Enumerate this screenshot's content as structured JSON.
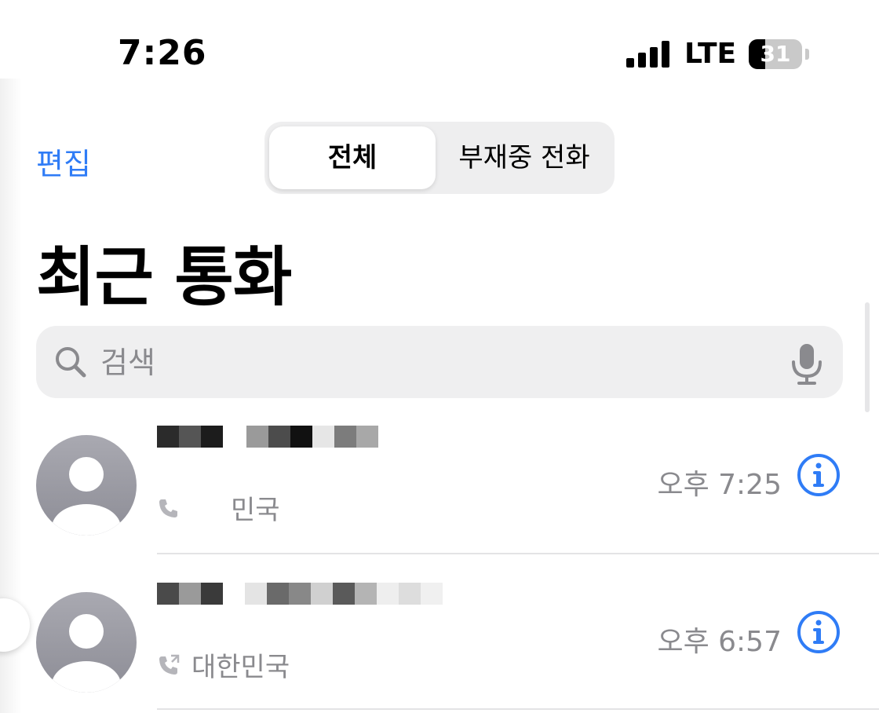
{
  "status_bar": {
    "time": "7:26",
    "network": "LTE",
    "battery": "31",
    "battery_level": 0.31
  },
  "nav": {
    "edit_label": "편집",
    "segments": [
      {
        "label": "전체",
        "selected": true
      },
      {
        "label": "부재중 전화",
        "selected": false
      }
    ]
  },
  "title": "최근 통화",
  "search": {
    "placeholder": "검색",
    "icon": "search-icon",
    "mic_icon": "microphone-icon"
  },
  "calls": [
    {
      "name": "",
      "subtitle": "민국",
      "time": "오후 7:25",
      "icon": "phone-outgoing-icon"
    },
    {
      "name": "",
      "subtitle": "대한민국",
      "time": "오후 6:57",
      "icon": "phone-outgoing-icon"
    }
  ],
  "colors": {
    "accent": "#2f7cf6",
    "secondary_text": "#8a8a8e",
    "avatar": "#a2a2aa"
  }
}
